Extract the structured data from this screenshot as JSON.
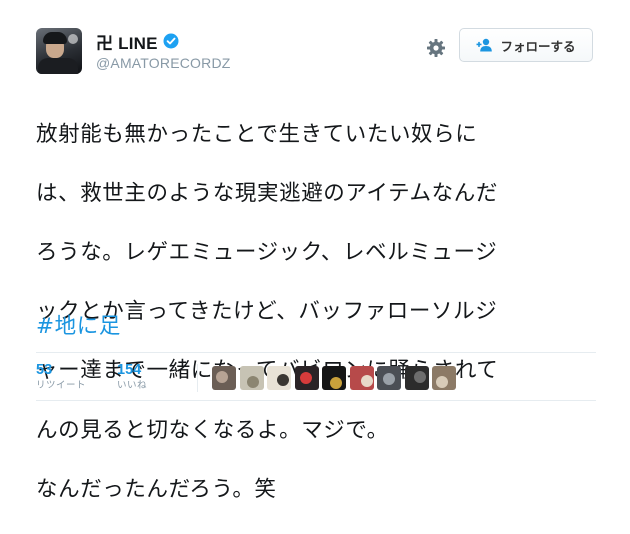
{
  "user": {
    "display_name": "卍 LINE",
    "handle": "@AMATORECORDZ",
    "verified": true
  },
  "actions": {
    "settings_icon": "gear-icon",
    "follow_label": "フォローする",
    "follow_icon": "person-add-icon"
  },
  "tweet": {
    "lines": [
      "放射能も無かったことで生きていたい奴らに",
      "は、救世主のような現実逃避のアイテムなんだ",
      "ろうな。レゲエミュージック、レベルミュージ",
      "ックとか言ってきたけど、バッファローソルジ",
      "ャー達まで一緒になってバビロンに踊らされて",
      "んの見ると切なくなるよ。マジで。",
      "なんだったんだろう。笑"
    ],
    "hashtag": "#地に足"
  },
  "stats": {
    "retweets": {
      "count": "53",
      "label": "リツイート"
    },
    "likes": {
      "count": "154",
      "label": "いいね"
    }
  },
  "likers": [
    {
      "name": "liker-avatar-1",
      "bg": "#6b5e55",
      "fg": "#b7a394"
    },
    {
      "name": "liker-avatar-2",
      "bg": "#c7c3b4",
      "fg": "#8b8571"
    },
    {
      "name": "liker-avatar-3",
      "bg": "#e8e2d6",
      "fg": "#3a3632"
    },
    {
      "name": "liker-avatar-4",
      "bg": "#2a2326",
      "fg": "#d63b3b"
    },
    {
      "name": "liker-avatar-5",
      "bg": "#161616",
      "fg": "#c9a13b"
    },
    {
      "name": "liker-avatar-6",
      "bg": "#b74a4a",
      "fg": "#e8d9c9"
    },
    {
      "name": "liker-avatar-7",
      "bg": "#4b4f55",
      "fg": "#9aa1a8"
    },
    {
      "name": "liker-avatar-8",
      "bg": "#2c2c2c",
      "fg": "#6d6d6d"
    },
    {
      "name": "liker-avatar-9",
      "bg": "#8c7a66",
      "fg": "#d8cbb8"
    }
  ],
  "colors": {
    "link": "#1b95e0",
    "verified": "#1da1f2",
    "muted": "#8899a6",
    "text": "#14171a"
  }
}
